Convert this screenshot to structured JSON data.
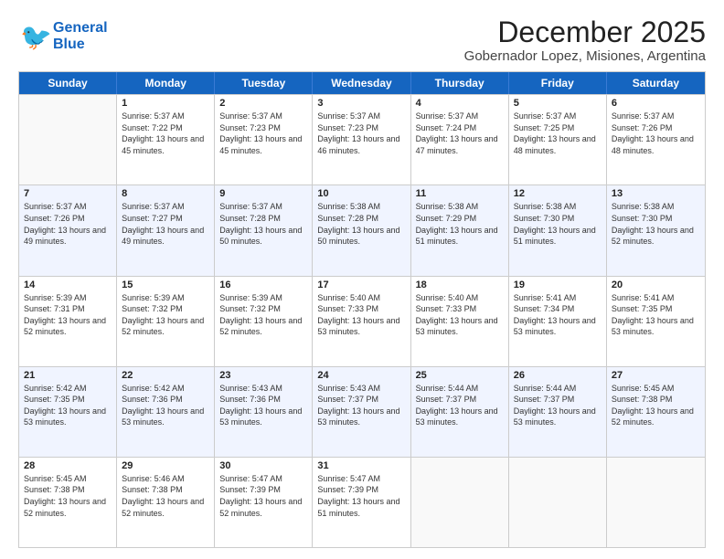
{
  "logo": {
    "line1": "General",
    "line2": "Blue"
  },
  "title": "December 2025",
  "subtitle": "Gobernador Lopez, Misiones, Argentina",
  "days": [
    "Sunday",
    "Monday",
    "Tuesday",
    "Wednesday",
    "Thursday",
    "Friday",
    "Saturday"
  ],
  "weeks": [
    [
      {
        "day": "",
        "sunrise": "",
        "sunset": "",
        "daylight": ""
      },
      {
        "day": "1",
        "sunrise": "Sunrise: 5:37 AM",
        "sunset": "Sunset: 7:22 PM",
        "daylight": "Daylight: 13 hours and 45 minutes."
      },
      {
        "day": "2",
        "sunrise": "Sunrise: 5:37 AM",
        "sunset": "Sunset: 7:23 PM",
        "daylight": "Daylight: 13 hours and 45 minutes."
      },
      {
        "day": "3",
        "sunrise": "Sunrise: 5:37 AM",
        "sunset": "Sunset: 7:23 PM",
        "daylight": "Daylight: 13 hours and 46 minutes."
      },
      {
        "day": "4",
        "sunrise": "Sunrise: 5:37 AM",
        "sunset": "Sunset: 7:24 PM",
        "daylight": "Daylight: 13 hours and 47 minutes."
      },
      {
        "day": "5",
        "sunrise": "Sunrise: 5:37 AM",
        "sunset": "Sunset: 7:25 PM",
        "daylight": "Daylight: 13 hours and 48 minutes."
      },
      {
        "day": "6",
        "sunrise": "Sunrise: 5:37 AM",
        "sunset": "Sunset: 7:26 PM",
        "daylight": "Daylight: 13 hours and 48 minutes."
      }
    ],
    [
      {
        "day": "7",
        "sunrise": "Sunrise: 5:37 AM",
        "sunset": "Sunset: 7:26 PM",
        "daylight": "Daylight: 13 hours and 49 minutes."
      },
      {
        "day": "8",
        "sunrise": "Sunrise: 5:37 AM",
        "sunset": "Sunset: 7:27 PM",
        "daylight": "Daylight: 13 hours and 49 minutes."
      },
      {
        "day": "9",
        "sunrise": "Sunrise: 5:37 AM",
        "sunset": "Sunset: 7:28 PM",
        "daylight": "Daylight: 13 hours and 50 minutes."
      },
      {
        "day": "10",
        "sunrise": "Sunrise: 5:38 AM",
        "sunset": "Sunset: 7:28 PM",
        "daylight": "Daylight: 13 hours and 50 minutes."
      },
      {
        "day": "11",
        "sunrise": "Sunrise: 5:38 AM",
        "sunset": "Sunset: 7:29 PM",
        "daylight": "Daylight: 13 hours and 51 minutes."
      },
      {
        "day": "12",
        "sunrise": "Sunrise: 5:38 AM",
        "sunset": "Sunset: 7:30 PM",
        "daylight": "Daylight: 13 hours and 51 minutes."
      },
      {
        "day": "13",
        "sunrise": "Sunrise: 5:38 AM",
        "sunset": "Sunset: 7:30 PM",
        "daylight": "Daylight: 13 hours and 52 minutes."
      }
    ],
    [
      {
        "day": "14",
        "sunrise": "Sunrise: 5:39 AM",
        "sunset": "Sunset: 7:31 PM",
        "daylight": "Daylight: 13 hours and 52 minutes."
      },
      {
        "day": "15",
        "sunrise": "Sunrise: 5:39 AM",
        "sunset": "Sunset: 7:32 PM",
        "daylight": "Daylight: 13 hours and 52 minutes."
      },
      {
        "day": "16",
        "sunrise": "Sunrise: 5:39 AM",
        "sunset": "Sunset: 7:32 PM",
        "daylight": "Daylight: 13 hours and 52 minutes."
      },
      {
        "day": "17",
        "sunrise": "Sunrise: 5:40 AM",
        "sunset": "Sunset: 7:33 PM",
        "daylight": "Daylight: 13 hours and 53 minutes."
      },
      {
        "day": "18",
        "sunrise": "Sunrise: 5:40 AM",
        "sunset": "Sunset: 7:33 PM",
        "daylight": "Daylight: 13 hours and 53 minutes."
      },
      {
        "day": "19",
        "sunrise": "Sunrise: 5:41 AM",
        "sunset": "Sunset: 7:34 PM",
        "daylight": "Daylight: 13 hours and 53 minutes."
      },
      {
        "day": "20",
        "sunrise": "Sunrise: 5:41 AM",
        "sunset": "Sunset: 7:35 PM",
        "daylight": "Daylight: 13 hours and 53 minutes."
      }
    ],
    [
      {
        "day": "21",
        "sunrise": "Sunrise: 5:42 AM",
        "sunset": "Sunset: 7:35 PM",
        "daylight": "Daylight: 13 hours and 53 minutes."
      },
      {
        "day": "22",
        "sunrise": "Sunrise: 5:42 AM",
        "sunset": "Sunset: 7:36 PM",
        "daylight": "Daylight: 13 hours and 53 minutes."
      },
      {
        "day": "23",
        "sunrise": "Sunrise: 5:43 AM",
        "sunset": "Sunset: 7:36 PM",
        "daylight": "Daylight: 13 hours and 53 minutes."
      },
      {
        "day": "24",
        "sunrise": "Sunrise: 5:43 AM",
        "sunset": "Sunset: 7:37 PM",
        "daylight": "Daylight: 13 hours and 53 minutes."
      },
      {
        "day": "25",
        "sunrise": "Sunrise: 5:44 AM",
        "sunset": "Sunset: 7:37 PM",
        "daylight": "Daylight: 13 hours and 53 minutes."
      },
      {
        "day": "26",
        "sunrise": "Sunrise: 5:44 AM",
        "sunset": "Sunset: 7:37 PM",
        "daylight": "Daylight: 13 hours and 53 minutes."
      },
      {
        "day": "27",
        "sunrise": "Sunrise: 5:45 AM",
        "sunset": "Sunset: 7:38 PM",
        "daylight": "Daylight: 13 hours and 52 minutes."
      }
    ],
    [
      {
        "day": "28",
        "sunrise": "Sunrise: 5:45 AM",
        "sunset": "Sunset: 7:38 PM",
        "daylight": "Daylight: 13 hours and 52 minutes."
      },
      {
        "day": "29",
        "sunrise": "Sunrise: 5:46 AM",
        "sunset": "Sunset: 7:38 PM",
        "daylight": "Daylight: 13 hours and 52 minutes."
      },
      {
        "day": "30",
        "sunrise": "Sunrise: 5:47 AM",
        "sunset": "Sunset: 7:39 PM",
        "daylight": "Daylight: 13 hours and 52 minutes."
      },
      {
        "day": "31",
        "sunrise": "Sunrise: 5:47 AM",
        "sunset": "Sunset: 7:39 PM",
        "daylight": "Daylight: 13 hours and 51 minutes."
      },
      {
        "day": "",
        "sunrise": "",
        "sunset": "",
        "daylight": ""
      },
      {
        "day": "",
        "sunrise": "",
        "sunset": "",
        "daylight": ""
      },
      {
        "day": "",
        "sunrise": "",
        "sunset": "",
        "daylight": ""
      }
    ]
  ]
}
